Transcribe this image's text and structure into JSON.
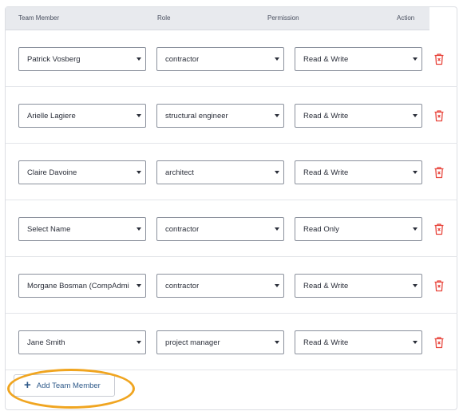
{
  "header": {
    "team_member": "Team Member",
    "role": "Role",
    "permission": "Permission",
    "action": "Action"
  },
  "rows": [
    {
      "member": "Patrick Vosberg",
      "role": "contractor",
      "permission": "Read & Write"
    },
    {
      "member": "Arielle Lagiere",
      "role": "structural engineer",
      "permission": "Read & Write"
    },
    {
      "member": "Claire Davoine",
      "role": "architect",
      "permission": "Read & Write"
    },
    {
      "member": "Select Name",
      "role": "contractor",
      "permission": "Read Only"
    },
    {
      "member": "Morgane Bosman (CompAdmin)",
      "role": "contractor",
      "permission": "Read & Write"
    },
    {
      "member": "Jane Smith",
      "role": "project manager",
      "permission": "Read & Write"
    }
  ],
  "add_button": {
    "label": "Add Team Member",
    "icon": "plus-icon"
  },
  "colors": {
    "delete": "#e8453c",
    "highlight": "#f0a520",
    "link": "#2f5a8a",
    "header_bg": "#e8eaee"
  },
  "icons": {
    "delete": "trash-icon",
    "dropdown": "chevron-down-icon"
  }
}
